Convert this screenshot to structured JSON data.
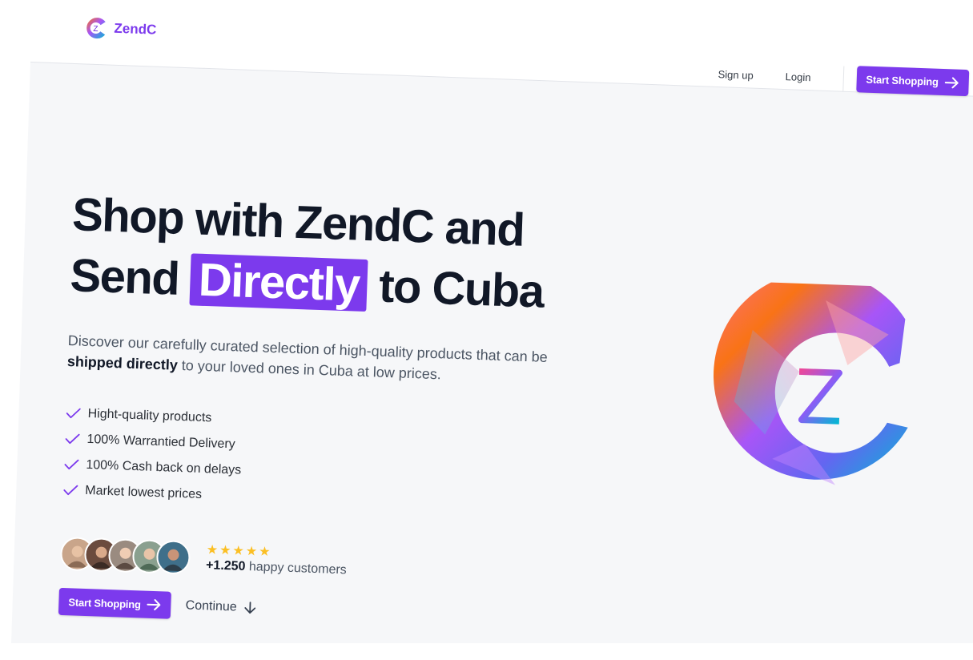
{
  "brand": {
    "name": "ZendC"
  },
  "nav": {
    "signup": "Sign up",
    "login": "Login",
    "start_shopping": "Start Shopping"
  },
  "hero": {
    "title_line1": "Shop with ZendC and",
    "title_line2_before": "Send",
    "title_highlight": "Directly",
    "title_line2_after": "to Cuba",
    "subtitle_before": "Discover our carefully curated selection of high-quality products that can be",
    "subtitle_bold": "shipped directly",
    "subtitle_after": "to your loved ones in Cuba at low prices."
  },
  "features": [
    "Hight-quality products",
    "100% Warrantied Delivery",
    "100% Cash back on delays",
    "Market lowest prices"
  ],
  "social_proof": {
    "rating_stars": 5,
    "count": "+1.250",
    "label": "happy customers"
  },
  "cta": {
    "primary": "Start Shopping",
    "secondary": "Continue"
  },
  "colors": {
    "accent": "#7c3aed",
    "star": "#fbbf24",
    "text": "#111827"
  }
}
